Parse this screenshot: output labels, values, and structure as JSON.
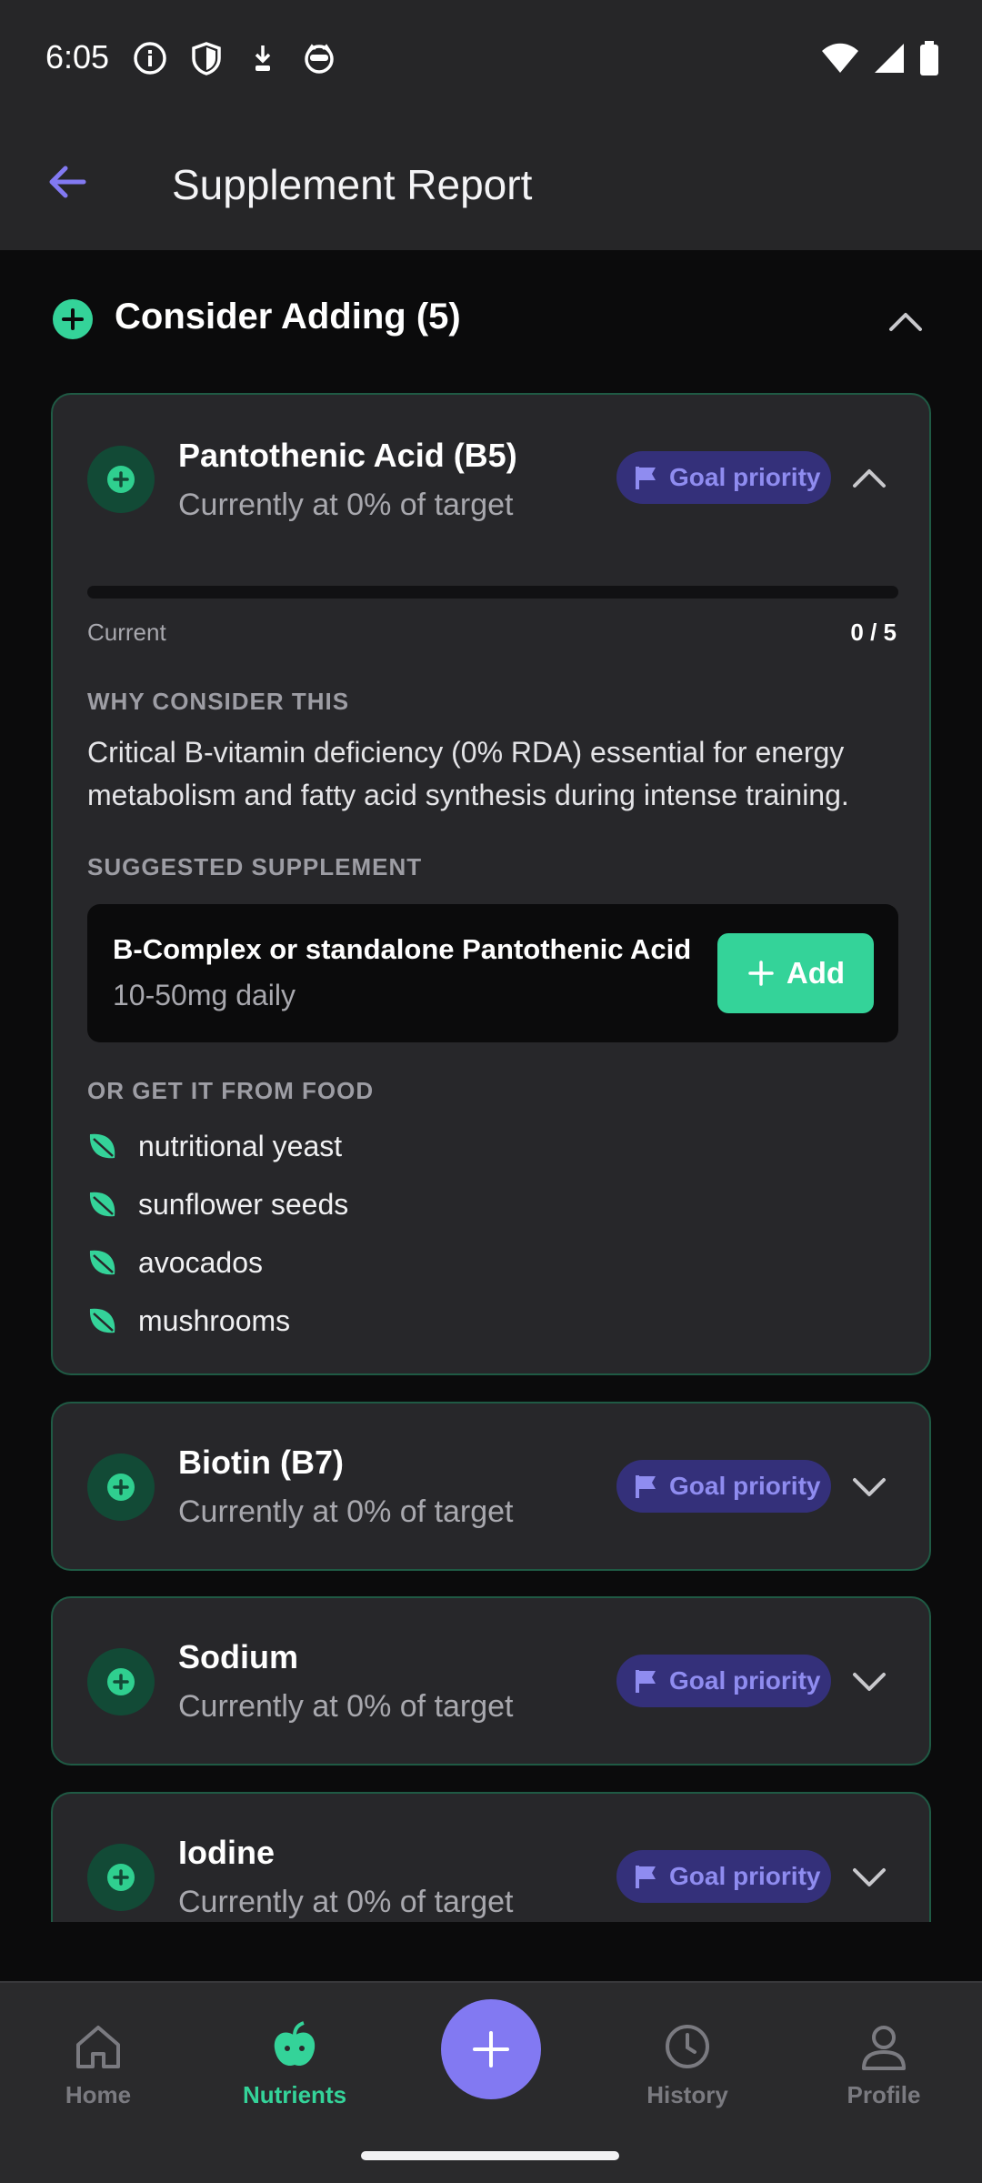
{
  "status_bar": {
    "time": "6:05"
  },
  "app_bar": {
    "title": "Supplement Report"
  },
  "section": {
    "title": "Consider Adding (5)"
  },
  "cards": [
    {
      "name": "Pantothenic Acid (B5)",
      "subtitle": "Currently at 0% of target",
      "badge": "Goal priority",
      "expanded": true,
      "progress_label": "Current",
      "progress_value": "0 / 5",
      "progress_fraction": 0,
      "why_heading": "WHY CONSIDER THIS",
      "why_text": "Critical B-vitamin deficiency (0% RDA) essential for energy metabolism and fatty acid synthesis during intense training.",
      "supp_heading": "SUGGESTED SUPPLEMENT",
      "supplement_name": "B-Complex or standalone Pantothenic Acid",
      "supplement_dose": "10-50mg daily",
      "add_label": "Add",
      "food_heading": "OR GET IT FROM FOOD",
      "foods": [
        "nutritional yeast",
        "sunflower seeds",
        "avocados",
        "mushrooms"
      ]
    },
    {
      "name": "Biotin (B7)",
      "subtitle": "Currently at 0% of target",
      "badge": "Goal priority",
      "expanded": false
    },
    {
      "name": "Sodium",
      "subtitle": "Currently at 0% of target",
      "badge": "Goal priority",
      "expanded": false
    },
    {
      "name": "Iodine",
      "subtitle": "Currently at 0% of target",
      "badge": "Goal priority",
      "expanded": false
    }
  ],
  "bottom_nav": {
    "items": [
      {
        "label": "Home",
        "icon": "home-icon",
        "active": false
      },
      {
        "label": "Nutrients",
        "icon": "apple-icon",
        "active": true
      },
      {
        "label": "History",
        "icon": "clock-icon",
        "active": false
      },
      {
        "label": "Profile",
        "icon": "person-icon",
        "active": false
      }
    ],
    "fab_icon": "plus-icon"
  },
  "colors": {
    "accent_green": "#34d399",
    "accent_purple": "#8279f2",
    "badge_bg": "#34307a",
    "card_border": "#1f5a44"
  }
}
